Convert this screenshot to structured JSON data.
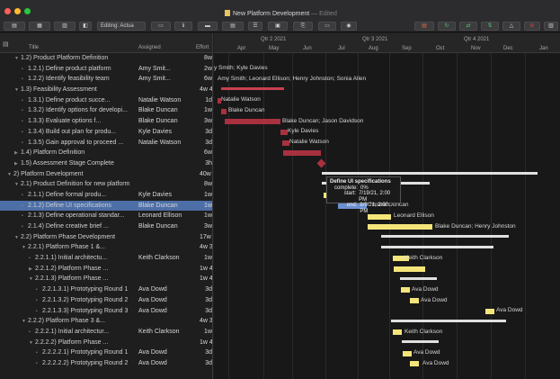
{
  "window": {
    "title": "New Platform Development",
    "edited": "— Edited",
    "editing_select": "Editing: Actua"
  },
  "columns": {
    "title": "Title",
    "assigned": "Assigned",
    "effort": "Effort"
  },
  "rows": [
    {
      "title": "1.2)  Product Platform Definition",
      "assigned": "",
      "effort": "8w",
      "indent": 2,
      "tri": "open"
    },
    {
      "title": "1.2.1)  Define product platform",
      "assigned": "Amy Smit...",
      "effort": "2w",
      "indent": 3,
      "tri": "none"
    },
    {
      "title": "1.2.2)  Identify feasibility team",
      "assigned": "Amy Smit...",
      "effort": "6w",
      "indent": 3,
      "tri": "none"
    },
    {
      "title": "1.3)  Feasibility Assessment",
      "assigned": "",
      "effort": "4w 4d 3h",
      "indent": 2,
      "tri": "open"
    },
    {
      "title": "1.3.1)  Define product succe...",
      "assigned": "Natalie Watson",
      "effort": "1d",
      "indent": 3,
      "tri": "none"
    },
    {
      "title": "1.3.2)  Identify options for developi...",
      "assigned": "Blake Duncan",
      "effort": "1w",
      "indent": 3,
      "tri": "none"
    },
    {
      "title": "1.3.3)  Evaluate options f...",
      "assigned": "Blake Duncan",
      "effort": "3w",
      "indent": 3,
      "tri": "none"
    },
    {
      "title": "1.3.4)  Build out plan for produ...",
      "assigned": "Kyle Davies",
      "effort": "3d",
      "indent": 3,
      "tri": "none"
    },
    {
      "title": "1.3.5)  Gain approval to proceed ...",
      "assigned": "Natalie Watson",
      "effort": "3d",
      "indent": 3,
      "tri": "none"
    },
    {
      "title": "1.4)  Platform Definition",
      "assigned": "",
      "effort": "6w",
      "indent": 2,
      "tri": "closed"
    },
    {
      "title": "1.5)  Assessment Stage Complete",
      "assigned": "",
      "effort": "3h",
      "indent": 2,
      "tri": "closed"
    },
    {
      "title": "2)  Platform Development",
      "assigned": "",
      "effort": "40w ...",
      "indent": 1,
      "tri": "open"
    },
    {
      "title": "2.1)  Product Definition for new platform",
      "assigned": "",
      "effort": "8w",
      "indent": 2,
      "tri": "open"
    },
    {
      "title": "2.1.1)  Define formal produ...",
      "assigned": "Kyle Davies",
      "effort": "1w",
      "indent": 3,
      "tri": "none"
    },
    {
      "title": "2.1.2)  Define UI specifications",
      "assigned": "Blake Duncan",
      "effort": "1w",
      "indent": 3,
      "tri": "none",
      "selected": true
    },
    {
      "title": "2.1.3)  Define operational standar...",
      "assigned": "Leonard Ellison",
      "effort": "1w",
      "indent": 3,
      "tri": "none"
    },
    {
      "title": "2.1.4)  Define creative brief ...",
      "assigned": "Blake Duncan",
      "effort": "3w",
      "indent": 3,
      "tri": "none"
    },
    {
      "title": "2.2)  Platform Phase Development",
      "assigned": "",
      "effort": "17w 1d",
      "indent": 2,
      "tri": "open"
    },
    {
      "title": "2.2.1)  Platform Phase 1 &...",
      "assigned": "",
      "effort": "4w 3d",
      "indent": 3,
      "tri": "open"
    },
    {
      "title": "2.2.1.1)  Initial architectu...",
      "assigned": "Keith Clarkson",
      "effort": "1w",
      "indent": 4,
      "tri": "none"
    },
    {
      "title": "2.2.1.2)  Platform Phase ...",
      "assigned": "",
      "effort": "1w 4d",
      "indent": 4,
      "tri": "closed"
    },
    {
      "title": "2.2.1.3)  Platform Phase ...",
      "assigned": "",
      "effort": "1w 4d",
      "indent": 4,
      "tri": "open"
    },
    {
      "title": "2.2.1.3.1)  Prototyping Round 1",
      "assigned": "Ava Dowd",
      "effort": "3d",
      "indent": 5,
      "tri": "none"
    },
    {
      "title": "2.2.1.3.2)  Prototyping Round 2",
      "assigned": "Ava Dowd",
      "effort": "3d",
      "indent": 5,
      "tri": "none"
    },
    {
      "title": "2.2.1.3.3)  Prototyping Round 3",
      "assigned": "Ava Dowd",
      "effort": "3d",
      "indent": 5,
      "tri": "none"
    },
    {
      "title": "2.2.2)  Platform Phase 3 &...",
      "assigned": "",
      "effort": "4w 3d",
      "indent": 3,
      "tri": "open"
    },
    {
      "title": "2.2.2.1)  Initial architectur...",
      "assigned": "Keith Clarkson",
      "effort": "1w",
      "indent": 4,
      "tri": "none"
    },
    {
      "title": "2.2.2.2)  Platform Phase ...",
      "assigned": "",
      "effort": "1w 4d",
      "indent": 4,
      "tri": "open"
    },
    {
      "title": "2.2.2.2.1)  Prototyping Round 1",
      "assigned": "Ava Dowd",
      "effort": "3d",
      "indent": 5,
      "tri": "none"
    },
    {
      "title": "2.2.2.2.2)  Prototyping Round 2",
      "assigned": "Ava Dowd",
      "effort": "3d",
      "indent": 5,
      "tri": "none"
    }
  ],
  "timeline": {
    "quarters": [
      "Qtr 2 2021",
      "Qtr 3 2021",
      "Qtr 4 2021"
    ],
    "months": [
      "Apr",
      "May",
      "Jun",
      "Jul",
      "Aug",
      "Sep",
      "Oct",
      "Nov",
      "Dec",
      "Jan"
    ]
  },
  "bar_labels": {
    "r1": "y Smith; Kyle Davies",
    "r2": "Amy Smith; Leonard Ellison; Henry Johnston; Sonia Allen",
    "r4": "Natalie Watson",
    "r5": "Blake Duncan",
    "r6": "Blake Duncan; Jason Davidson",
    "r7": "Kyle Davies",
    "r8": "Natalie Watson",
    "r14": "Blake Duncan",
    "r15": "Leonard Ellison",
    "r16": "Blake Duncan; Henry Johnston",
    "r19": "Keith Clarkson",
    "r22": "Ava Dowd",
    "r23": "Ava Dowd",
    "r24": "Ava Dowd",
    "r26": "Keith Clarkson",
    "r28": "Ava Dowd",
    "r29": "Ava Dowd"
  },
  "tooltip": {
    "title": "Define UI specifications",
    "complete_label": "complete:",
    "complete": "0%",
    "start_label": "start:",
    "start": "7/19/21, 2:00 PM",
    "end_label": "end:",
    "end": "8/9/21, 2:00 PM"
  },
  "colors": {
    "critical": "#a8313f",
    "task": "#f4e57a",
    "selected": "#6c8fcf"
  }
}
